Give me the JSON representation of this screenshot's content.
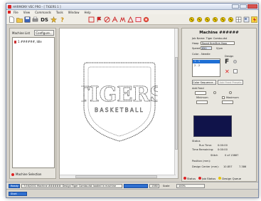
{
  "window": {
    "title": "HARMONY VEC PRO - [ TIGERS 1 ]"
  },
  "menu": {
    "items": [
      "File",
      "View",
      "Commands",
      "Tools",
      "Window",
      "Help"
    ]
  },
  "toolbar": {
    "left_icons": [
      "new-file-icon",
      "open-folder-icon",
      "save-icon",
      "print-icon",
      "ds-icon",
      "properties-icon",
      "help-icon"
    ],
    "center_icons": [
      "box-icon",
      "red-flag-icon",
      "stop-icon",
      "text-icon",
      "monogram-icon",
      "shape-icon",
      "image-icon",
      "thread-icon"
    ],
    "right_icons": [
      "stitch-1-icon",
      "stitch-2-icon",
      "stitch-3-icon",
      "stitch-4-icon",
      "stitch-5-icon",
      "stitch-6-icon",
      "grid-icon",
      "tile-icon",
      "lightning-icon"
    ],
    "ds_label": "DS"
  },
  "left_panel": {
    "header": "Machine List",
    "configure_label": "Configure...",
    "machine": "1 ######, Idle",
    "footer": "Machine Selection"
  },
  "design": {
    "main_text": "TIGERS",
    "sub_text": "BASKETBALL"
  },
  "right_panel": {
    "title": "Machine ######",
    "job_name_label": "Job Name: Tiger Combo.dst",
    "hoop_label": "Hoop",
    "hoop_value": "Round 6cm/8cm Hoop",
    "speed_label": "Speed",
    "speed_value": "850",
    "speed_unit": "S/pm",
    "color_needle_label": "Color - Needle",
    "colors": [
      "1 - 1",
      "2 - 2"
    ],
    "design_label": "Design",
    "color_sequence_label": "Color Sequence...",
    "add_feed_label": "Add Feed Presets",
    "add_feed_heading": "Add Feed",
    "minimum_label": "Minimum",
    "maximum_label": "Maximum",
    "status_label": "Status",
    "run_time_label": "Run Time:",
    "run_time_value": "0:00:00",
    "time_remaining_label": "Time Remaining:",
    "time_remaining_value": "0:00:00",
    "stitch_label": "Stitch",
    "stitch_value": "0 of 13887",
    "position_label": "Position (mm):",
    "design_center_label": "Design Center (mm):",
    "design_center_x": "10.857",
    "design_center_y": "7.386",
    "tabs": [
      "Status",
      "Job Status",
      "Design Queue"
    ]
  },
  "statusbar": {
    "mode": "Ready",
    "message": "7/16/2001 Machine ######: Design Tiger Combo.dst loaded in machine",
    "zoom_label": "1380",
    "scale_label": "Scale",
    "zoom_field": "100%",
    "taskbar": "Start"
  },
  "colors": {
    "accent": "#2f6fd0",
    "brand_red": "#d22222",
    "status_display": "#10134a"
  }
}
